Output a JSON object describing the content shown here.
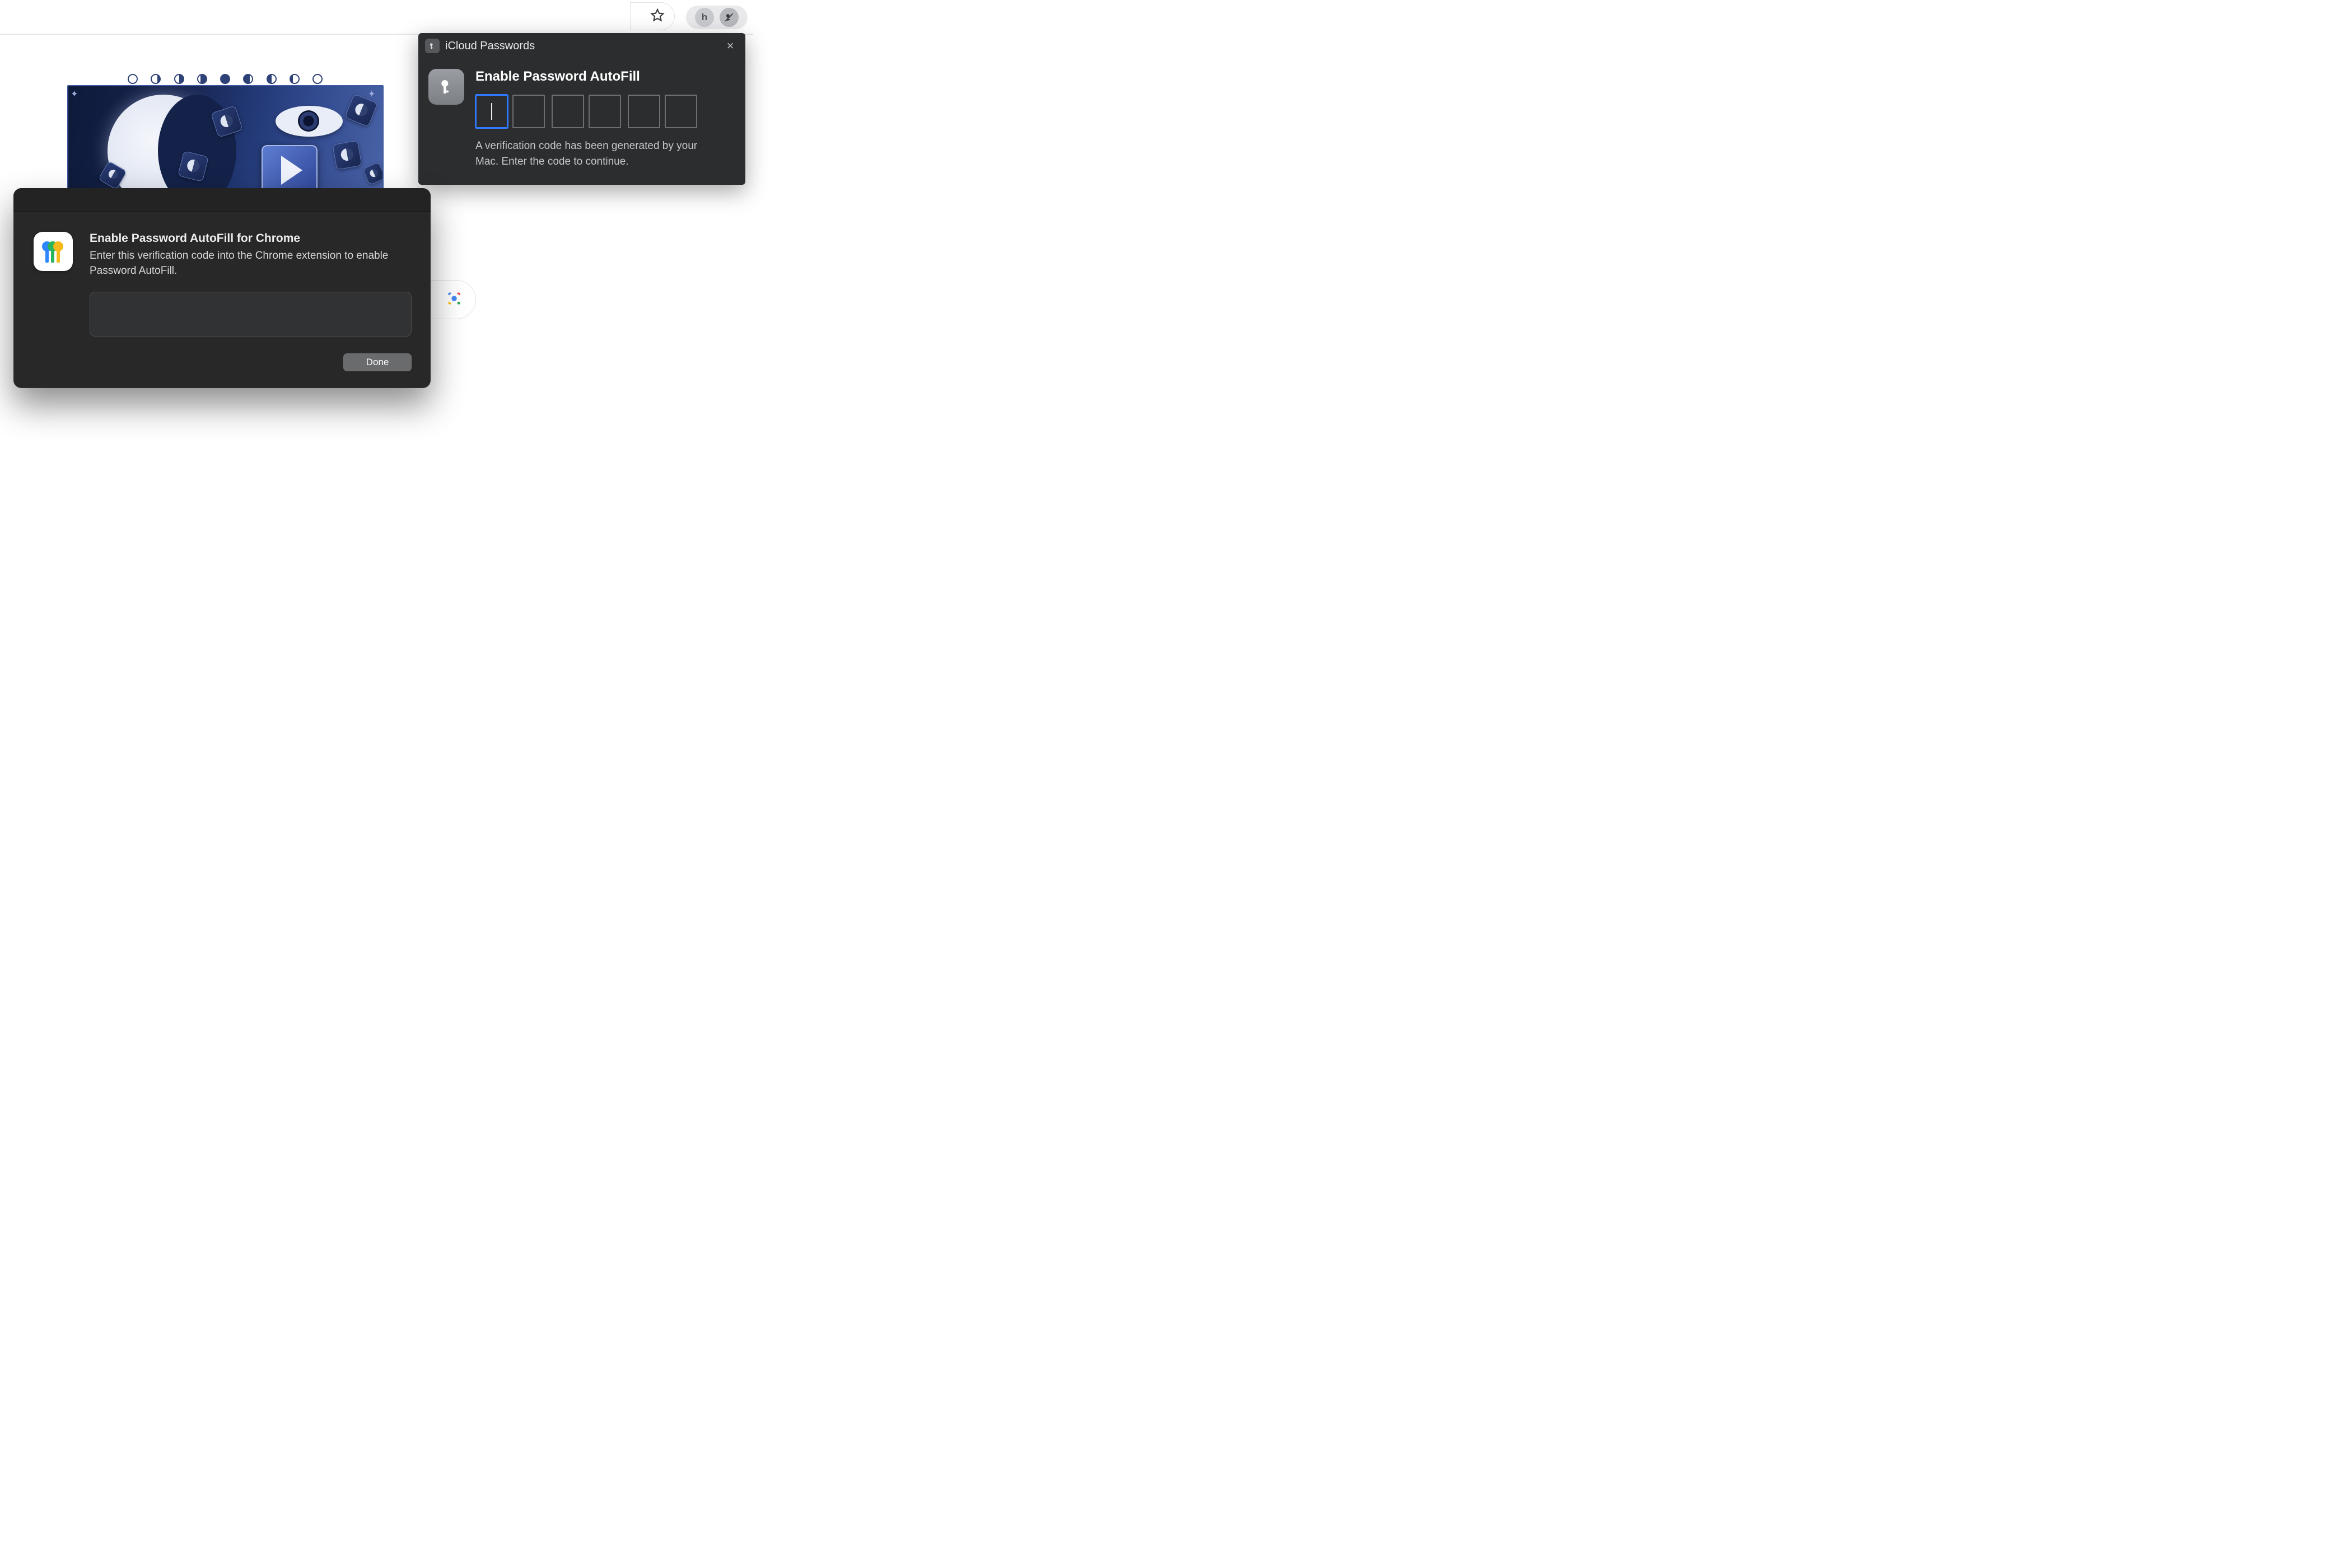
{
  "toolbar": {
    "star_icon": "star",
    "ext1_letter": "h",
    "ext2_icon": "key-off"
  },
  "popup": {
    "header_title": "iCloud Passwords",
    "close_label": "×",
    "heading": "Enable Password AutoFill",
    "code_boxes": 6,
    "focused_index": 0,
    "hint": "A verification code has been generated by your Mac. Enter the code to continue."
  },
  "dialog": {
    "heading": "Enable Password AutoFill for Chrome",
    "subtext": "Enter this verification code into the Chrome extension to enable Password AutoFill.",
    "code_value": "",
    "done_label": "Done"
  },
  "page": {
    "lens_icon": "google-lens"
  }
}
